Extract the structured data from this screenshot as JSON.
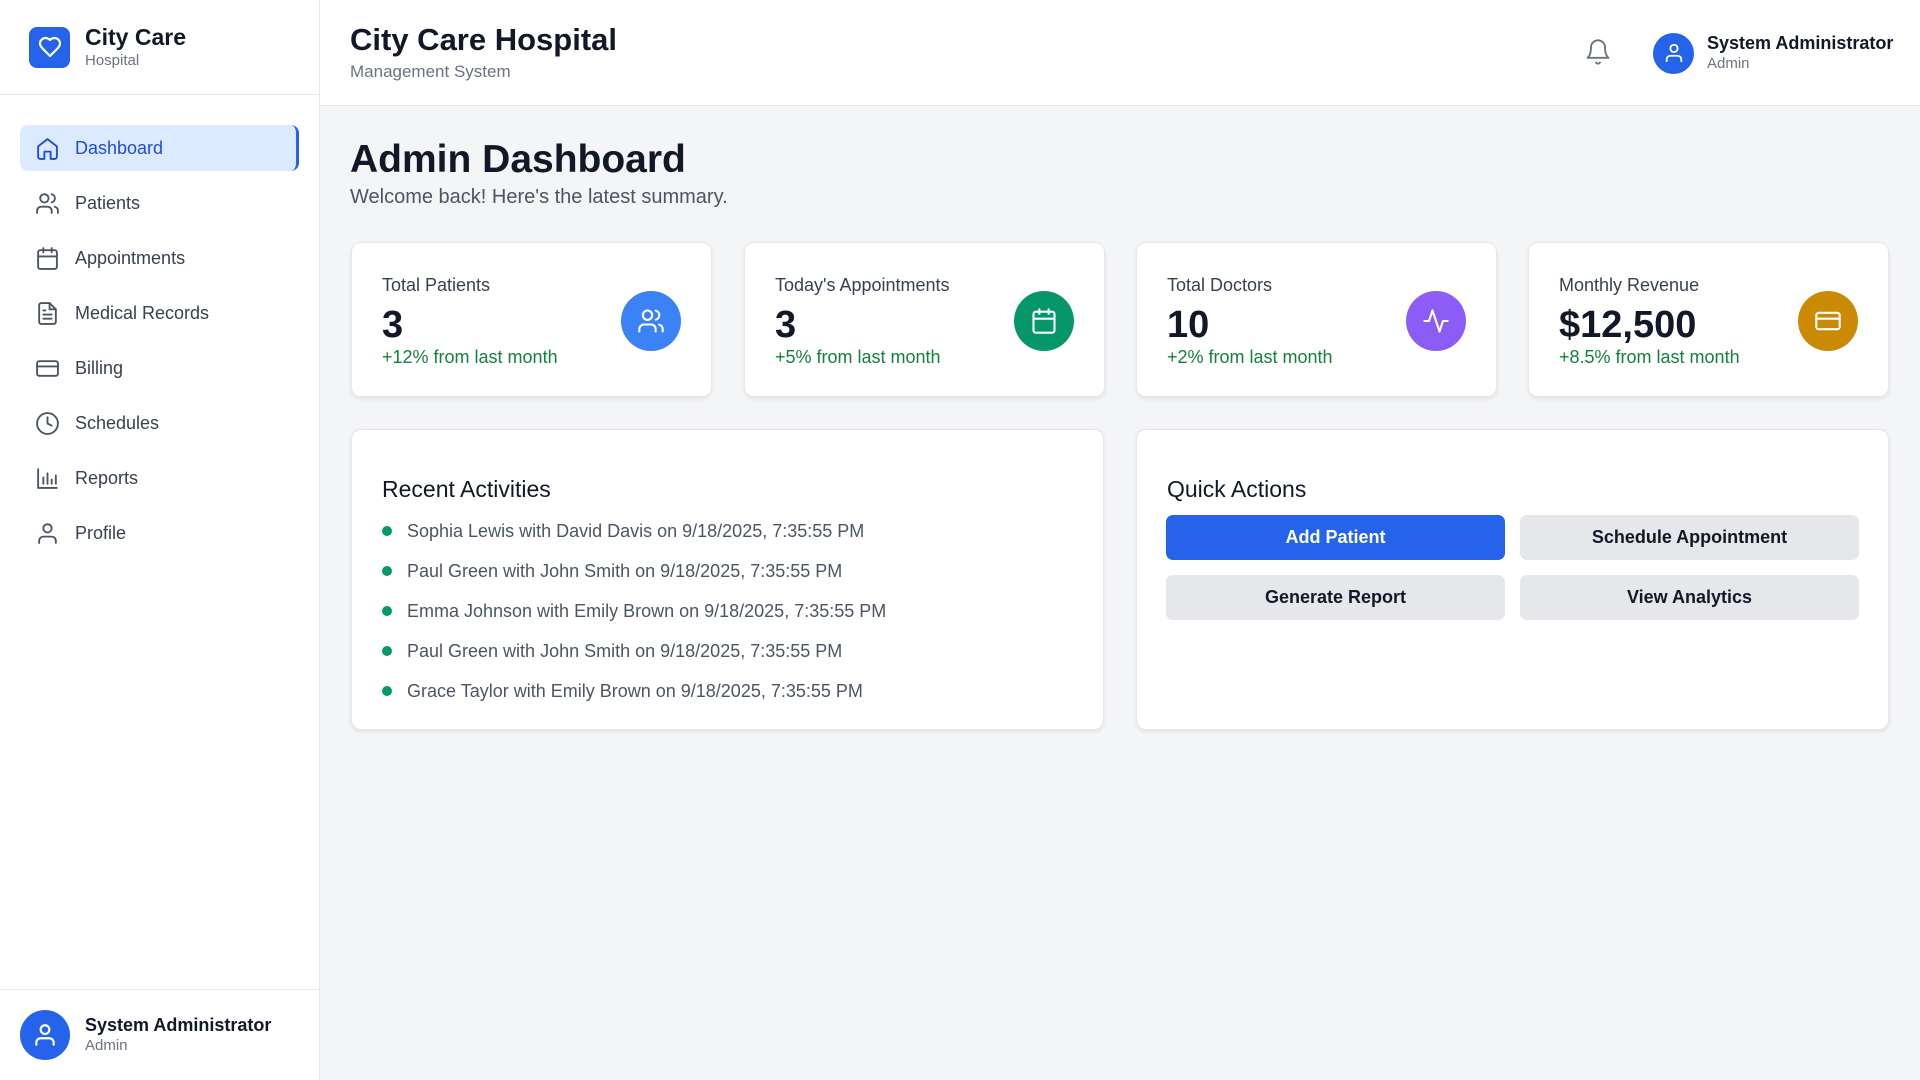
{
  "brand": {
    "name": "City Care",
    "subtitle": "Hospital",
    "logo_icon": "heart-icon",
    "accent": "#2563eb"
  },
  "sidebar": {
    "items": [
      {
        "label": "Dashboard",
        "icon": "home-icon",
        "active": true
      },
      {
        "label": "Patients",
        "icon": "users-icon"
      },
      {
        "label": "Appointments",
        "icon": "calendar-icon"
      },
      {
        "label": "Medical Records",
        "icon": "document-icon"
      },
      {
        "label": "Billing",
        "icon": "credit-card-icon"
      },
      {
        "label": "Schedules",
        "icon": "clock-icon"
      },
      {
        "label": "Reports",
        "icon": "bar-chart-icon"
      },
      {
        "label": "Profile",
        "icon": "user-icon"
      }
    ],
    "footer_user": {
      "name": "System Administrator",
      "role": "Admin"
    }
  },
  "header": {
    "title": "City Care Hospital",
    "subtitle": "Management System",
    "user": {
      "name": "System Administrator",
      "role": "Admin"
    }
  },
  "page": {
    "title": "Admin Dashboard",
    "subtitle": "Welcome back! Here's the latest summary."
  },
  "stats": [
    {
      "label": "Total Patients",
      "value": "3",
      "change": "+12% from last month",
      "icon": "users-icon",
      "color": "#3b82f6"
    },
    {
      "label": "Today's Appointments",
      "value": "3",
      "change": "+5% from last month",
      "icon": "calendar-icon",
      "color": "#059669"
    },
    {
      "label": "Total Doctors",
      "value": "10",
      "change": "+2% from last month",
      "icon": "activity-icon",
      "color": "#8b5cf6"
    },
    {
      "label": "Monthly Revenue",
      "value": "$12,500",
      "change": "+8.5% from last month",
      "icon": "credit-card-icon",
      "color": "#ca8a04"
    }
  ],
  "recent_activities": {
    "title": "Recent Activities",
    "items": [
      "Sophia Lewis with David Davis on 9/18/2025, 7:35:55 PM",
      "Paul Green with John Smith on 9/18/2025, 7:35:55 PM",
      "Emma Johnson with Emily Brown on 9/18/2025, 7:35:55 PM",
      "Paul Green with John Smith on 9/18/2025, 7:35:55 PM",
      "Grace Taylor with Emily Brown on 9/18/2025, 7:35:55 PM"
    ]
  },
  "quick_actions": {
    "title": "Quick Actions",
    "buttons": [
      "Add Patient",
      "Schedule Appointment",
      "Generate Report",
      "View Analytics"
    ]
  }
}
